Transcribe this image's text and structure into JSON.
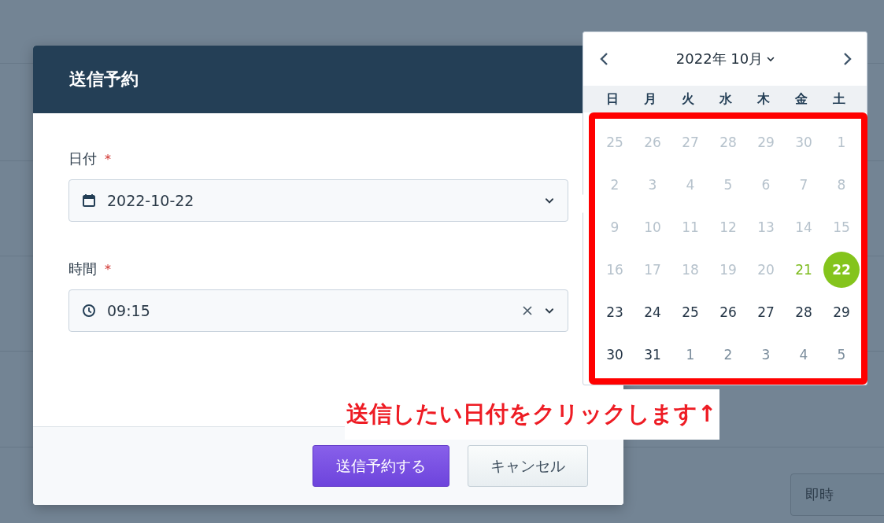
{
  "dialog": {
    "title": "送信予約",
    "fields": [
      {
        "label": "日付",
        "required_mark": "*",
        "kind": "date",
        "value": "2022-10-22",
        "clearable": false
      },
      {
        "label": "時間",
        "required_mark": "*",
        "kind": "time",
        "value": "09:15",
        "clearable": true
      }
    ],
    "buttons": [
      {
        "label": "送信予約する",
        "kind": "primary"
      },
      {
        "label": "キャンセル",
        "kind": "secondary"
      }
    ]
  },
  "calendar": {
    "month_label": "2022年 10月",
    "weekdays": [
      "日",
      "月",
      "火",
      "水",
      "木",
      "金",
      "土"
    ],
    "days": [
      {
        "label": "25",
        "kind": "outside",
        "selected": false
      },
      {
        "label": "26",
        "kind": "outside",
        "selected": false
      },
      {
        "label": "27",
        "kind": "outside",
        "selected": false
      },
      {
        "label": "28",
        "kind": "outside",
        "selected": false
      },
      {
        "label": "29",
        "kind": "outside",
        "selected": false
      },
      {
        "label": "30",
        "kind": "outside",
        "selected": false
      },
      {
        "label": "1",
        "kind": "disabled",
        "selected": false
      },
      {
        "label": "2",
        "kind": "disabled",
        "selected": false
      },
      {
        "label": "3",
        "kind": "disabled",
        "selected": false
      },
      {
        "label": "4",
        "kind": "disabled",
        "selected": false
      },
      {
        "label": "5",
        "kind": "disabled",
        "selected": false
      },
      {
        "label": "6",
        "kind": "disabled",
        "selected": false
      },
      {
        "label": "7",
        "kind": "disabled",
        "selected": false
      },
      {
        "label": "8",
        "kind": "disabled",
        "selected": false
      },
      {
        "label": "9",
        "kind": "disabled",
        "selected": false
      },
      {
        "label": "10",
        "kind": "disabled",
        "selected": false
      },
      {
        "label": "11",
        "kind": "disabled",
        "selected": false
      },
      {
        "label": "12",
        "kind": "disabled",
        "selected": false
      },
      {
        "label": "13",
        "kind": "disabled",
        "selected": false
      },
      {
        "label": "14",
        "kind": "disabled",
        "selected": false
      },
      {
        "label": "15",
        "kind": "disabled",
        "selected": false
      },
      {
        "label": "16",
        "kind": "disabled",
        "selected": false
      },
      {
        "label": "17",
        "kind": "disabled",
        "selected": false
      },
      {
        "label": "18",
        "kind": "disabled",
        "selected": false
      },
      {
        "label": "19",
        "kind": "disabled",
        "selected": false
      },
      {
        "label": "20",
        "kind": "disabled",
        "selected": false
      },
      {
        "label": "21",
        "kind": "today",
        "selected": false
      },
      {
        "label": "22",
        "kind": "normal",
        "selected": true
      },
      {
        "label": "23",
        "kind": "normal",
        "selected": false
      },
      {
        "label": "24",
        "kind": "normal",
        "selected": false
      },
      {
        "label": "25",
        "kind": "normal",
        "selected": false
      },
      {
        "label": "26",
        "kind": "normal",
        "selected": false
      },
      {
        "label": "27",
        "kind": "normal",
        "selected": false
      },
      {
        "label": "28",
        "kind": "normal",
        "selected": false
      },
      {
        "label": "29",
        "kind": "normal",
        "selected": false
      },
      {
        "label": "30",
        "kind": "normal",
        "selected": false
      },
      {
        "label": "31",
        "kind": "normal",
        "selected": false
      },
      {
        "label": "1",
        "kind": "next",
        "selected": false
      },
      {
        "label": "2",
        "kind": "next",
        "selected": false
      },
      {
        "label": "3",
        "kind": "next",
        "selected": false
      },
      {
        "label": "4",
        "kind": "next",
        "selected": false
      },
      {
        "label": "5",
        "kind": "next",
        "selected": false
      }
    ]
  },
  "annotation": {
    "text": "送信したい日付をクリックします↑"
  },
  "background": {
    "mode_field": "即時"
  }
}
